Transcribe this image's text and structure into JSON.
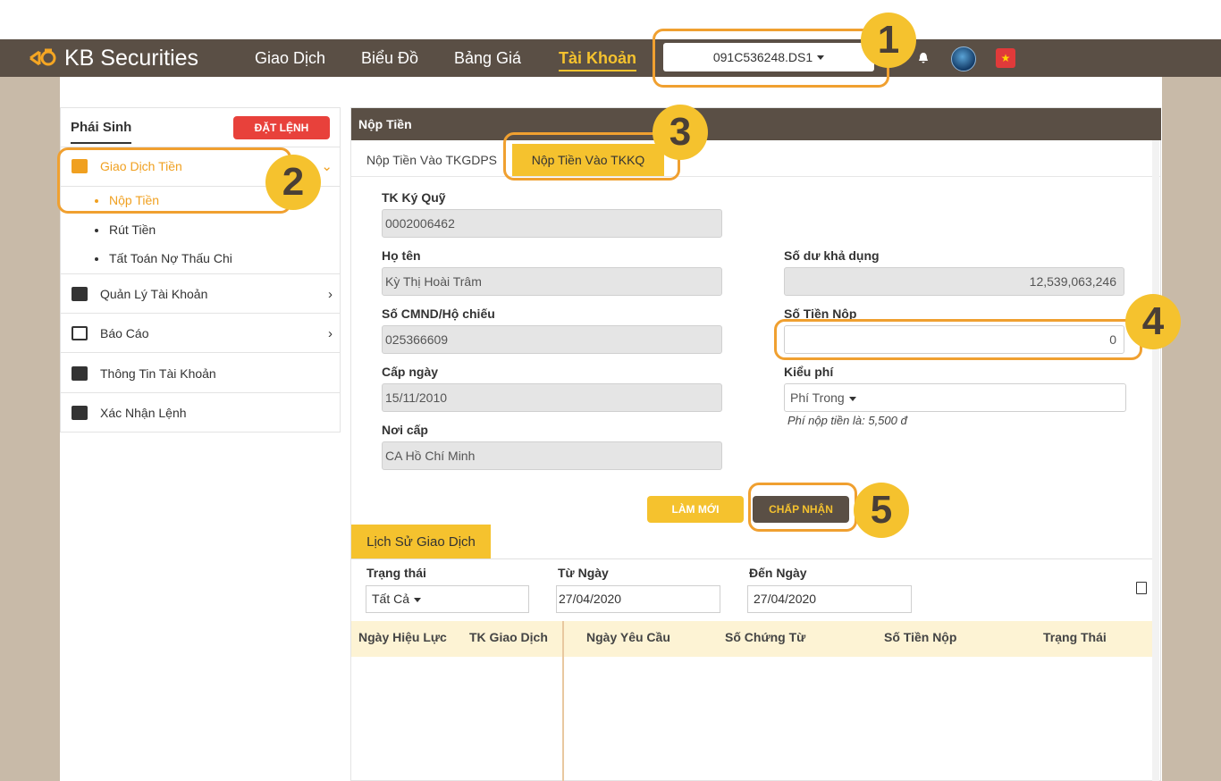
{
  "brand": {
    "name": "KB Securities"
  },
  "nav": {
    "items": [
      "Giao Dịch",
      "Biểu Đồ",
      "Bảng Giá",
      "Tài Khoản"
    ],
    "active": "Tài Khoản",
    "account": "091C536248.DS1"
  },
  "sidebar": {
    "tab": "Phái Sinh",
    "order_button": "ĐẶT LỆNH",
    "menu": [
      {
        "label": "Giao Dịch Tiền",
        "icon": "cash-icon"
      },
      {
        "label": "Quản Lý Tài Khoản",
        "icon": "account-card-icon"
      },
      {
        "label": "Báo Cáo",
        "icon": "report-icon"
      },
      {
        "label": "Thông Tin Tài Khoản",
        "icon": "user-info-icon"
      },
      {
        "label": "Xác Nhận Lệnh",
        "icon": "checkbox-icon"
      }
    ],
    "submenu": [
      "Nộp Tiền",
      "Rút Tiền",
      "Tất Toán Nợ Thấu Chi"
    ]
  },
  "panel": {
    "title": "Nộp Tiền",
    "tabs": [
      "Nộp Tiền Vào TKGDPS",
      "Nộp Tiền Vào TKKQ"
    ],
    "form": {
      "margin_account_label": "TK Ký Quỹ",
      "margin_account": "0002006462",
      "name_label": "Họ tên",
      "name": "Kỳ Thị Hoài Trâm",
      "id_label": "Số CMND/Hộ chiếu",
      "id_number": "025366609",
      "issue_date_label": "Cấp ngày",
      "issue_date": "15/11/2010",
      "issue_place_label": "Nơi cấp",
      "issue_place": "CA Hồ Chí Minh",
      "balance_label": "Số dư khả dụng",
      "balance": "12,539,063,246",
      "amount_label": "Số Tiền Nộp",
      "amount": "0",
      "fee_type_label": "Kiểu phí",
      "fee_type": "Phí Trong",
      "fee_hint": "Phí nộp tiền là: 5,500 đ"
    },
    "buttons": {
      "reset": "LÀM MỚI",
      "accept": "CHẤP NHẬN"
    }
  },
  "history": {
    "tab": "Lịch Sử Giao Dịch",
    "filters": {
      "status_label": "Trạng thái",
      "status": "Tất Cả",
      "from_label": "Từ Ngày",
      "from": "27/04/2020",
      "to_label": "Đến Ngày",
      "to": "27/04/2020"
    },
    "columns": [
      "Ngày Hiệu Lực",
      "TK Giao Dịch",
      "Ngày Yêu Cầu",
      "Số Chứng Từ",
      "Số Tiền Nộp",
      "Trạng Thái"
    ]
  },
  "callouts": [
    "1",
    "2",
    "3",
    "4",
    "5"
  ],
  "colors": {
    "brand_dark": "#5a4f45",
    "accent_yellow": "#f5c22e",
    "highlight_orange": "#f0a030",
    "danger": "#e8413b"
  }
}
